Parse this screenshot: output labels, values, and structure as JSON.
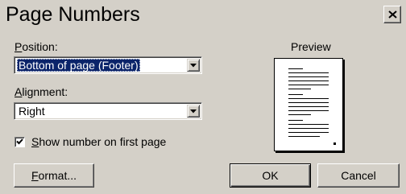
{
  "window": {
    "title": "Page Numbers",
    "close_icon": "close-icon"
  },
  "position": {
    "label_accel": "P",
    "label_rest": "osition:",
    "value": "Bottom of page (Footer)"
  },
  "alignment": {
    "label_accel": "A",
    "label_rest": "lignment:",
    "value": "Right"
  },
  "first_page": {
    "checked": true,
    "label_accel": "S",
    "label_rest": "how number on first page"
  },
  "preview": {
    "label": "Preview"
  },
  "buttons": {
    "format_accel": "F",
    "format_rest": "ormat...",
    "ok": "OK",
    "cancel": "Cancel"
  }
}
